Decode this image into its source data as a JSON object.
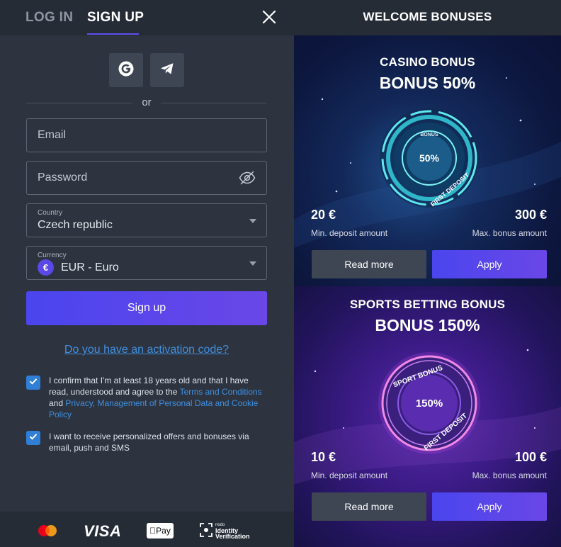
{
  "tabs": {
    "login": "LOG IN",
    "signup": "SIGN UP"
  },
  "social": {
    "or": "or"
  },
  "form": {
    "email_placeholder": "Email",
    "password_placeholder": "Password",
    "country_label": "Country",
    "country_value": "Czech republic",
    "currency_label": "Currency",
    "currency_symbol": "€",
    "currency_value": "EUR - Euro",
    "signup_button": "Sign up",
    "activation_link": "Do you have an activation code?"
  },
  "consent": {
    "c1_part1": "I confirm that I'm at least 18 years old and that I have read, understood and agree to the ",
    "c1_link1": "Terms and Conditions",
    "c1_part2": " and ",
    "c1_link2": "Privacy, Management of Personal Data and Cookie Policy",
    "c2": "I want to receive personalized offers and bonuses via email, push and SMS"
  },
  "payments": {
    "visa": "VISA",
    "applepay": "Pay",
    "idv_small": "nodo",
    "idv_line1": "Identity",
    "idv_line2": "Verification"
  },
  "bonuses": {
    "header": "WELCOME BONUSES",
    "casino": {
      "title": "CASINO BONUS",
      "bonus": "BONUS 50%",
      "badge_top": "BONUS",
      "badge_pct": "50%",
      "badge_ring": "FIRST DEPOSIT",
      "min_amount": "20 €",
      "min_label": "Min. deposit amount",
      "max_amount": "300 €",
      "max_label": "Max. bonus amount",
      "read_more": "Read more",
      "apply": "Apply"
    },
    "sports": {
      "title": "SPORTS BETTING BONUS",
      "bonus": "BONUS 150%",
      "badge_top": "SPORT BONUS",
      "badge_pct": "150%",
      "badge_ring": "FIRST DEPOSIT",
      "min_amount": "10 €",
      "min_label": "Min. deposit amount",
      "max_amount": "100 €",
      "max_label": "Max. bonus amount",
      "read_more": "Read more",
      "apply": "Apply"
    }
  },
  "colors": {
    "accent": "#5d4ef0",
    "link": "#3f8fde",
    "checkbox": "#2f7fd6"
  }
}
